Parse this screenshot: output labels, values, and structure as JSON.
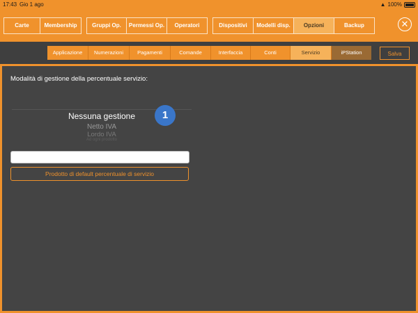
{
  "status": {
    "time": "17:43",
    "date": "Gio 1 ago",
    "battery": "100%"
  },
  "main_tabs": {
    "group1": [
      "Carte",
      "Membership"
    ],
    "group2": [
      "Gruppi Op.",
      "Permessi Op.",
      "Operatori"
    ],
    "group3": [
      "Dispositivi",
      "Modelli disp.",
      "Opzioni",
      "Backup"
    ],
    "active": "Opzioni"
  },
  "sub_tabs": [
    "Applicazione",
    "Numerazioni",
    "Pagamenti",
    "Comande",
    "Interfaccia",
    "Conti",
    "Servizio",
    "iPStation"
  ],
  "active_sub_tab": "Servizio",
  "save_label": "Salva",
  "section_title": "Modalità di gestione della percentuale servizio:",
  "picker": {
    "options": [
      "Nessuna gestione",
      "Netto IVA",
      "Lordo IVA",
      "Ad ogni prodotto"
    ],
    "selected": "Nessuna gestione"
  },
  "badge": "1",
  "text_field_value": "",
  "default_button_label": "Prodotto di default percentuale di servizio",
  "colors": {
    "accent": "#f0922c",
    "background": "#444444",
    "badge": "#3a76c9"
  }
}
